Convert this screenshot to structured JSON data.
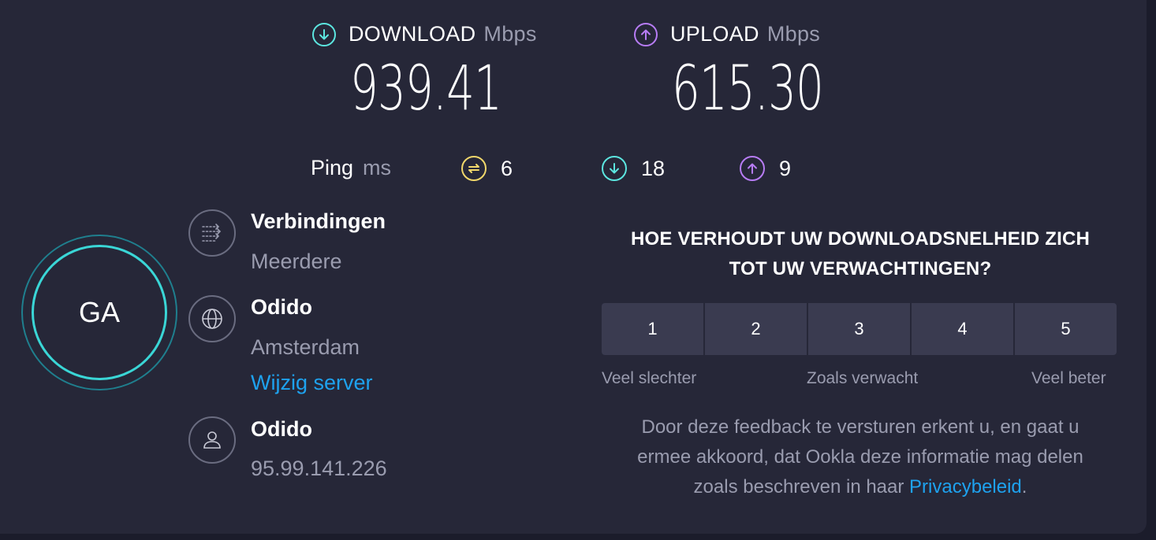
{
  "download": {
    "label": "DOWNLOAD",
    "unit": "Mbps",
    "value": "939.41",
    "icon": "arrow-down-circle-icon",
    "color": "#5ce6e0"
  },
  "upload": {
    "label": "UPLOAD",
    "unit": "Mbps",
    "value": "615.30",
    "icon": "arrow-up-circle-icon",
    "color": "#b77cf5"
  },
  "ping": {
    "label": "Ping",
    "unit": "ms",
    "idle": {
      "value": "6",
      "icon": "ping-idle-icon",
      "color": "#f2d86b"
    },
    "download": {
      "value": "18",
      "icon": "arrow-down-circle-icon",
      "color": "#5ce6e0"
    },
    "upload": {
      "value": "9",
      "icon": "arrow-up-circle-icon",
      "color": "#b77cf5"
    }
  },
  "gauge": {
    "label": "GA"
  },
  "connections": {
    "title": "Verbindingen",
    "value": "Meerdere",
    "icon": "connections-icon"
  },
  "server": {
    "title": "Odido",
    "location": "Amsterdam",
    "change_link": "Wijzig server",
    "icon": "globe-icon"
  },
  "provider": {
    "title": "Odido",
    "ip": "95.99.141.226",
    "icon": "user-icon"
  },
  "survey": {
    "question_line1": "HOE VERHOUDT UW DOWNLOADSNELHEID ZICH",
    "question_line2": "TOT UW VERWACHTINGEN?",
    "ratings": [
      "1",
      "2",
      "3",
      "4",
      "5"
    ],
    "label_low": "Veel slechter",
    "label_mid": "Zoals verwacht",
    "label_high": "Veel beter",
    "disclaimer_line1": "Door deze feedback te versturen erkent u, en gaat u",
    "disclaimer_line2": "ermee akkoord, dat Ookla deze informatie mag delen",
    "disclaimer_line3_prefix": "zoals beschreven in haar ",
    "privacy_link": "Privacybeleid",
    "disclaimer_line3_suffix": "."
  }
}
